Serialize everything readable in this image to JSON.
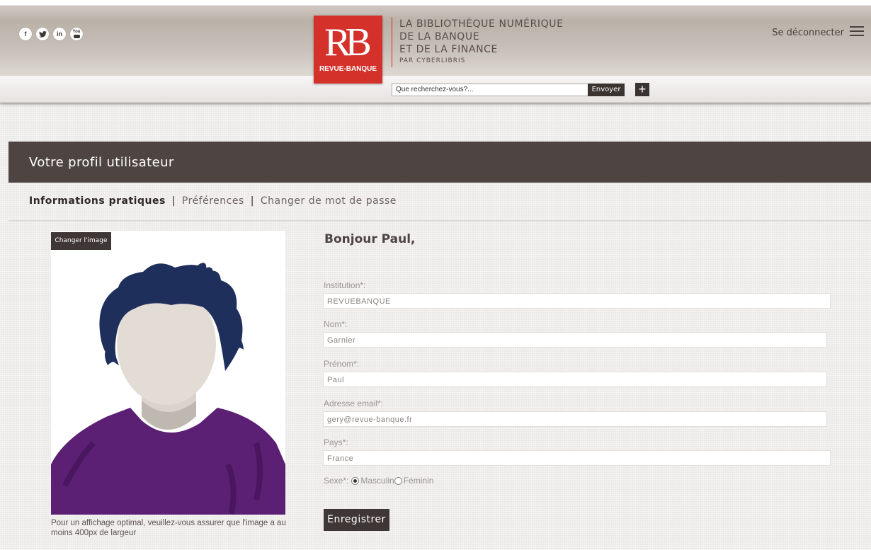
{
  "header": {
    "social": [
      {
        "icon": "facebook-icon",
        "glyph": "f"
      },
      {
        "icon": "twitter-icon",
        "glyph": "✓"
      },
      {
        "icon": "linkedin-icon",
        "glyph": "in"
      },
      {
        "icon": "youtube-icon",
        "glyph": "You"
      }
    ],
    "logo": {
      "letters": "RB",
      "caption": "REVUE-BANQUE"
    },
    "brand": {
      "line1": "LA BIBLIOTHÈQUE NUMÉRIQUE",
      "line2": "DE LA BANQUE",
      "line3": "ET DE LA FINANCE",
      "byline": "PAR CYBERLIBRIS"
    },
    "logout_label": "Se déconnecter",
    "search": {
      "placeholder": "Que recherchez-vous?...",
      "button_label": "Envoyer",
      "plus_label": "+"
    }
  },
  "page": {
    "title": "Votre profil utilisateur",
    "subnav": {
      "active": "Informations pratiques",
      "sep": "|",
      "item2": "Préférences",
      "item3": "Changer de mot de passe"
    }
  },
  "avatar": {
    "change_label": "Changer l'image",
    "note": "Pour un affichage optimal, veuillez-vous assurer que l'image a au moins 400px de largeur"
  },
  "form": {
    "greeting": "Bonjour Paul,",
    "institution": {
      "label": "Institution*:",
      "value": "REVUEBANQUE"
    },
    "nom": {
      "label": "Nom*:",
      "value": "Garnier"
    },
    "prenom": {
      "label": "Prénom*:",
      "value": "Paul"
    },
    "email": {
      "label": "Adresse email*:",
      "value": "gery@revue-banque.fr"
    },
    "pays": {
      "label": "Pays*:",
      "value": "France"
    },
    "sexe": {
      "label": "Sexe*:",
      "option1": "Masculin",
      "option2": "Féminin",
      "selected": "Masculin"
    },
    "save_label": "Enregistrer"
  },
  "colors": {
    "brand_red": "#d4312b",
    "dark_bar": "#4e4442",
    "hair": "#1f2f5c",
    "shirt": "#5b1f73"
  }
}
